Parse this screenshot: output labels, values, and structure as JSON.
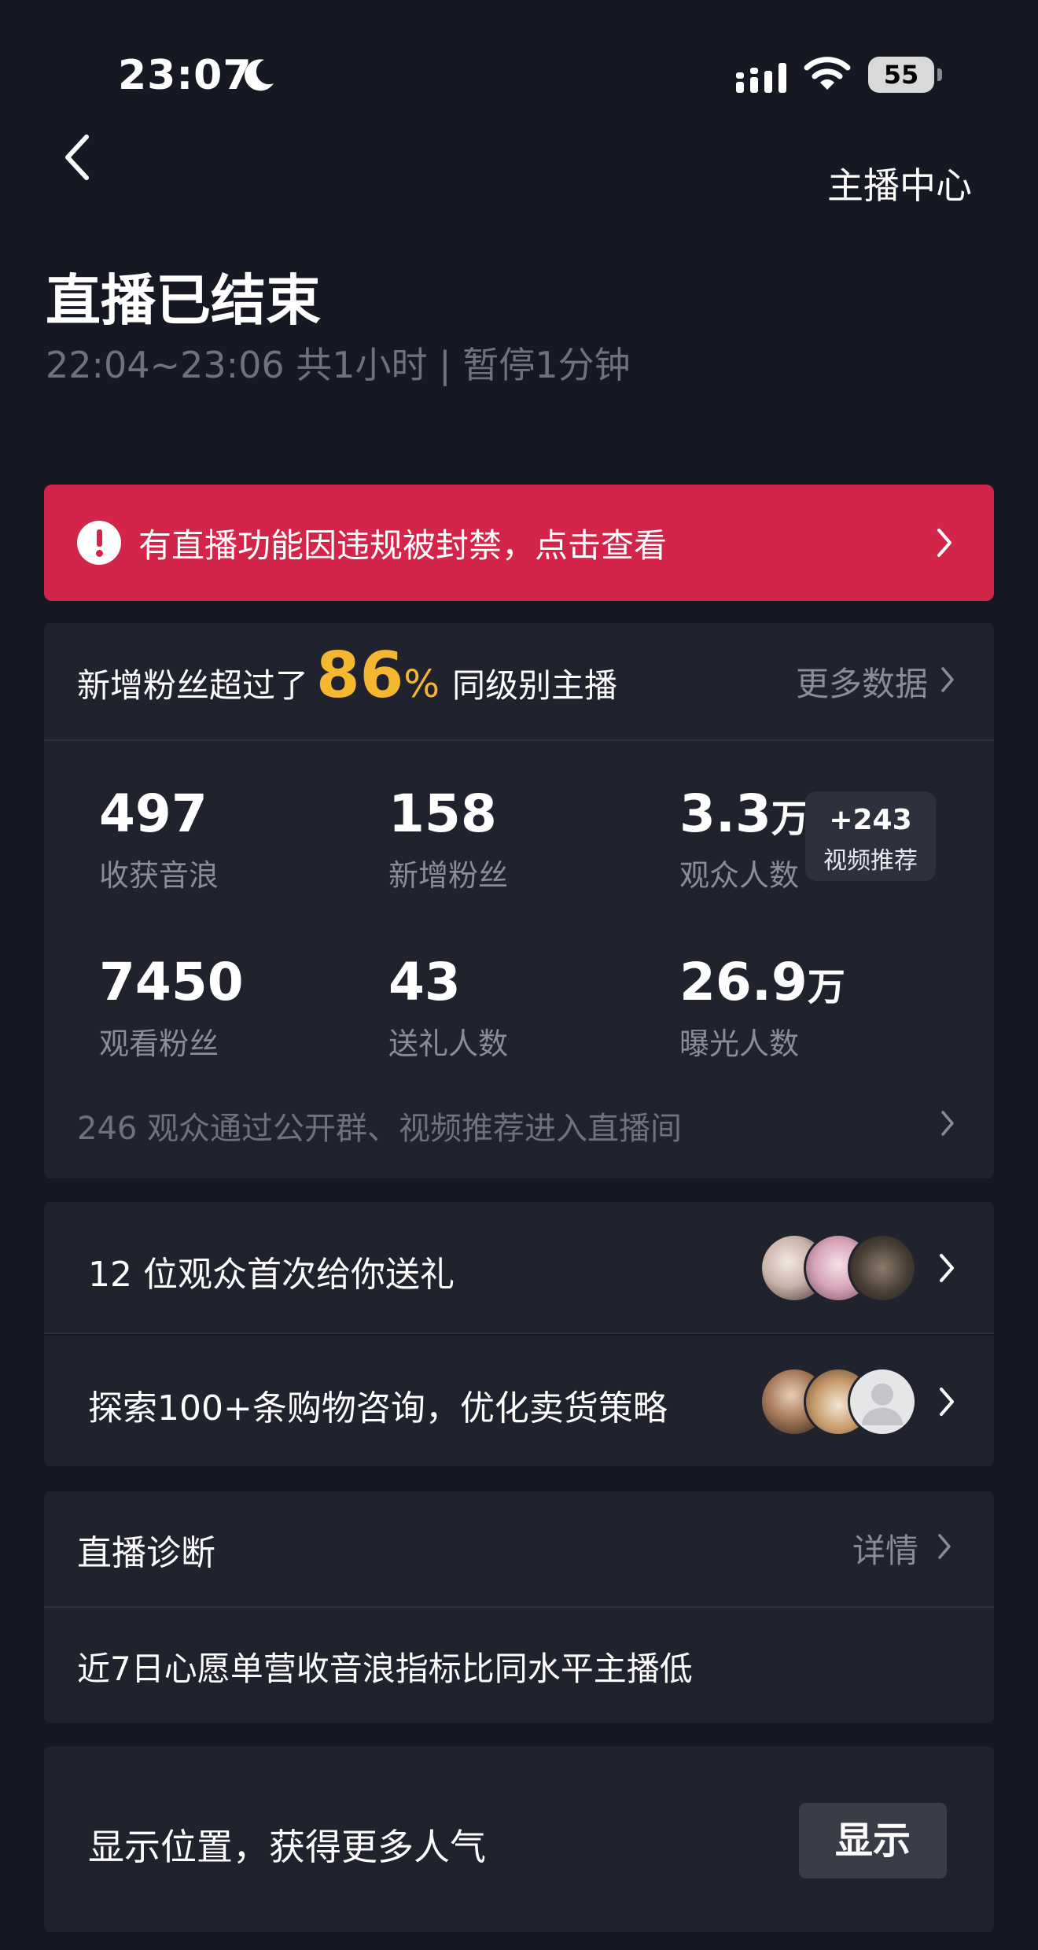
{
  "status_bar": {
    "time": "23:07",
    "battery": "55",
    "icons": [
      "moon-icon",
      "signal-icon",
      "wifi-icon",
      "battery-icon"
    ]
  },
  "header": {
    "back_icon": "chevron-left-icon",
    "right_link": "主播中心",
    "title": "直播已结束",
    "subtitle": "22:04~23:06 共1小时 | 暂停1分钟"
  },
  "alert": {
    "icon": "exclamation-circle-icon",
    "text": "有直播功能因违规被封禁，点击查看",
    "color": "#d3244a"
  },
  "stats": {
    "headline_prefix": "新增粉丝超过了",
    "headline_percent": "86",
    "headline_percent_sign": "%",
    "headline_suffix": "同级别主播",
    "more_label": "更多数据",
    "highlight_color": "#f5b630",
    "items": [
      {
        "value": "497",
        "unit": "",
        "label": "收获音浪"
      },
      {
        "value": "158",
        "unit": "",
        "label": "新增粉丝"
      },
      {
        "value": "3.3",
        "unit": "万",
        "label": "观众人数"
      },
      {
        "value": "7450",
        "unit": "",
        "label": "观看粉丝"
      },
      {
        "value": "43",
        "unit": "",
        "label": "送礼人数"
      },
      {
        "value": "26.9",
        "unit": "万",
        "label": "曝光人数"
      }
    ],
    "badge": {
      "value": "+243",
      "label": "视频推荐"
    },
    "footer": "246 观众通过公开群、视频推荐进入直播间"
  },
  "rows": [
    {
      "text": "12 位观众首次给你送礼"
    },
    {
      "text": "探索100+条购物咨询，优化卖货策略"
    }
  ],
  "diagnosis": {
    "title": "直播诊断",
    "more_label": "详情",
    "message": "近7日心愿单营收音浪指标比同水平主播低"
  },
  "location": {
    "text": "显示位置，获得更多人气",
    "button": "显示"
  }
}
